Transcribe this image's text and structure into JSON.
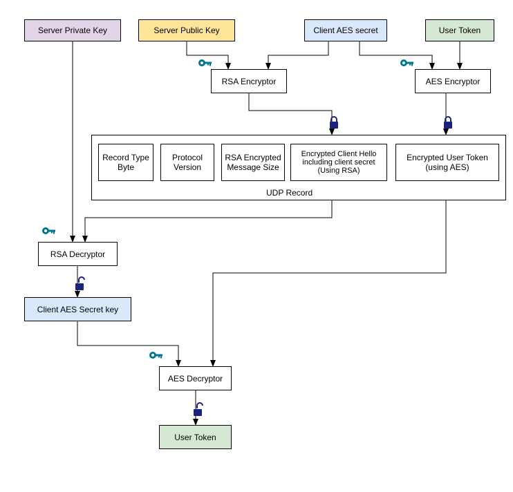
{
  "inputs": {
    "server_private_key": "Server Private Key",
    "server_public_key": "Server Public Key",
    "client_aes_secret": "Client AES secret",
    "user_token": "User Token"
  },
  "encryptors": {
    "rsa": "RSA Encryptor",
    "aes": "AES Encryptor"
  },
  "udp_record": {
    "label": "UDP Record",
    "fields": {
      "record_type_byte": "Record Type Byte",
      "protocol_version": "Protocol Version",
      "rsa_encrypted_message_size": "RSA Encrypted Message Size",
      "encrypted_client_hello": "Encrypted Client Hello including client secret (Using RSA)",
      "encrypted_user_token": "Encrypted User Token (using AES)"
    }
  },
  "decryptors": {
    "rsa": "RSA Decryptor",
    "aes": "AES Decryptor"
  },
  "outputs": {
    "client_aes_secret_key": "Client AES Secret key",
    "user_token": "User Token"
  },
  "colors": {
    "purple": "#e1d5e7",
    "yellow": "#ffe599",
    "blue": "#dae8fc",
    "green": "#d5e8d4",
    "key_icon": "#00758f",
    "lock_icon": "#1a237e"
  }
}
